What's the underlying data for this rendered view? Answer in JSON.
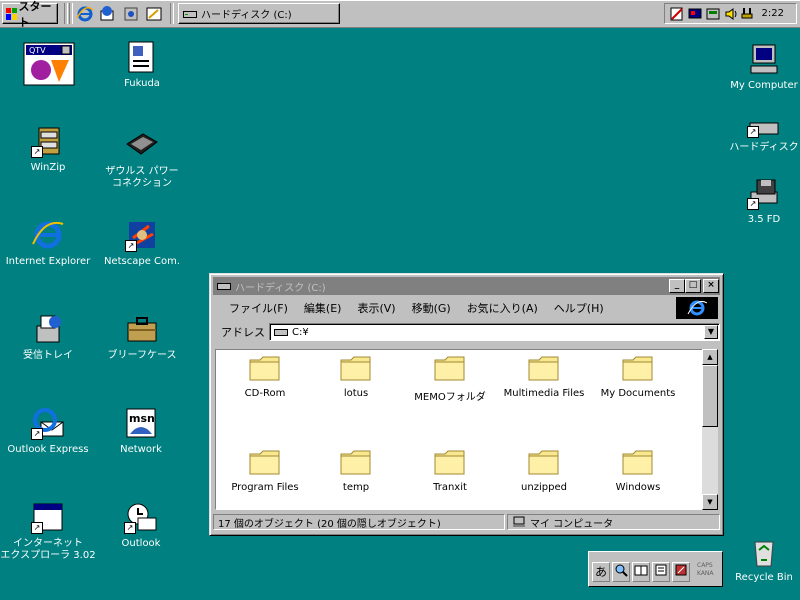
{
  "taskbar": {
    "start_label": "スタート",
    "task_window_label": "ハードディスク (C:)",
    "clock": "2:22"
  },
  "desktop": {
    "left_icons": [
      {
        "label": "",
        "icon": "qv-icon"
      },
      {
        "label": "Fukuda",
        "icon": "document-icon"
      },
      {
        "label": "WinZip",
        "icon": "winzip-icon"
      },
      {
        "label": "ザウルス パワー\nコネクション",
        "icon": "zaurus-icon"
      },
      {
        "label": "Internet Explorer",
        "icon": "ie-icon"
      },
      {
        "label": "Netscape Com.",
        "icon": "netscape-icon"
      },
      {
        "label": "受信トレイ",
        "icon": "inbox-icon"
      },
      {
        "label": "ブリーフケース",
        "icon": "briefcase-icon"
      },
      {
        "label": "Outlook Express",
        "icon": "outlook-express-icon"
      },
      {
        "label": "Network",
        "icon": "msn-icon"
      },
      {
        "label": "インターネット\nエクスプローラ 3.02",
        "icon": "ie-setup-icon"
      },
      {
        "label": "Outlook",
        "icon": "outlook-icon"
      }
    ],
    "right_icons": [
      {
        "label": "My Computer",
        "icon": "my-computer-icon"
      },
      {
        "label": "ハードディスク",
        "icon": "hard-disk-icon"
      },
      {
        "label": "3.5 FD",
        "icon": "floppy-icon"
      },
      {
        "label": "Recycle Bin",
        "icon": "recycle-bin-icon"
      }
    ]
  },
  "window": {
    "title": "ハードディスク (C:)",
    "menu": [
      "ファイル(F)",
      "編集(E)",
      "表示(V)",
      "移動(G)",
      "お気に入り(A)",
      "ヘルプ(H)"
    ],
    "address_label": "アドレス",
    "address_value": "C:¥",
    "folders": [
      "CD-Rom",
      "lotus",
      "MEMOフォルダ",
      "Multimedia Files",
      "My Documents",
      "Program Files",
      "temp",
      "Tranxit",
      "unzipped",
      "Windows"
    ],
    "status_left": "17 個のオブジェクト (20 個の隠しオブジェクト)",
    "status_right": "マイ コンピュータ"
  },
  "ime": {
    "mode": "あ",
    "caps": "CAPS",
    "kana": "KANA"
  },
  "colors": {
    "desktop": "#008080",
    "inactive_title": "#808080",
    "folder": "#f8e890"
  }
}
